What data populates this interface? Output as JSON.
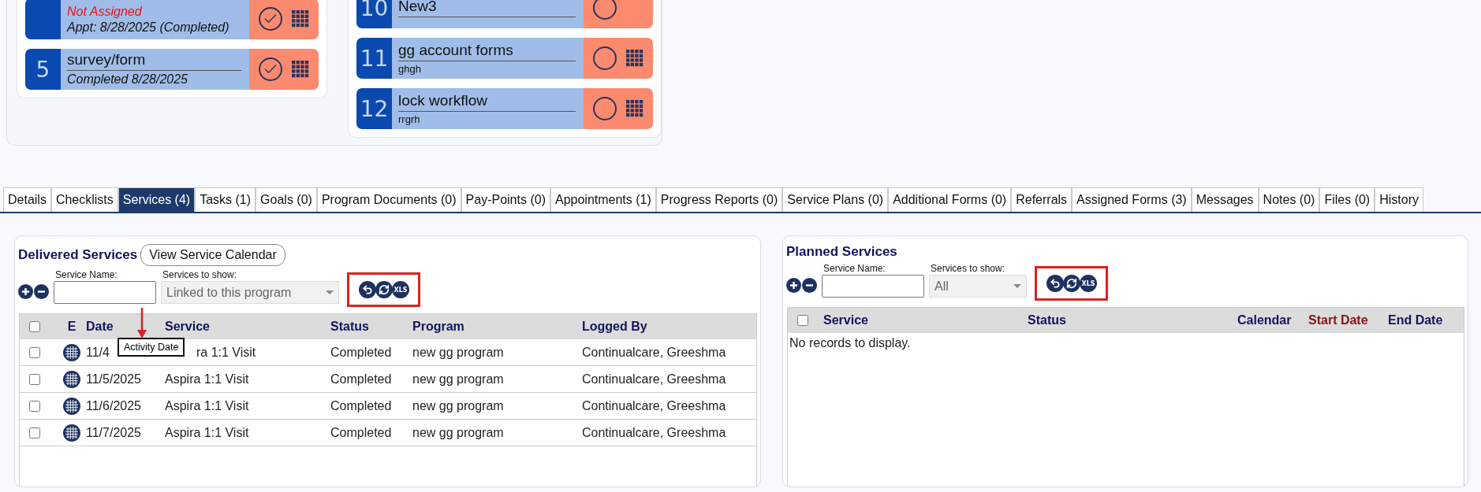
{
  "card_columns": [
    [
      {
        "lines": [
          {
            "text": "Not Assigned",
            "kind": "alert"
          },
          {
            "text": "Appt: 8/28/2025 (Completed)",
            "kind": "italic"
          }
        ],
        "done": true,
        "grid": true
      },
      {
        "number": "5",
        "title": "survey/form",
        "lines": [
          {
            "text": "Completed 8/28/2025",
            "kind": "italic"
          }
        ],
        "done": true,
        "grid": true
      }
    ],
    [
      {
        "number": "10",
        "title": "New3",
        "done": false,
        "grid": false
      },
      {
        "number": "11",
        "title": "gg account forms",
        "lines": [
          {
            "text": "ghgh",
            "kind": "plain"
          }
        ],
        "done": false,
        "grid": true
      },
      {
        "number": "12",
        "title": "lock workflow",
        "lines": [
          {
            "text": "rrgrh",
            "kind": "plain"
          }
        ],
        "done": false,
        "grid": true
      }
    ]
  ],
  "tabs": [
    {
      "label": "Details",
      "selected": false
    },
    {
      "label": "Checklists",
      "selected": false
    },
    {
      "label": "Services (4)",
      "selected": true
    },
    {
      "label": "Tasks (1)",
      "selected": false
    },
    {
      "label": "Goals (0)",
      "selected": false
    },
    {
      "label": "Program Documents (0)",
      "selected": false
    },
    {
      "label": "Pay-Points (0)",
      "selected": false
    },
    {
      "label": "Appointments (1)",
      "selected": false
    },
    {
      "label": "Progress Reports (0)",
      "selected": false
    },
    {
      "label": "Service Plans (0)",
      "selected": false
    },
    {
      "label": "Additional Forms (0)",
      "selected": false
    },
    {
      "label": "Referrals",
      "selected": false
    },
    {
      "label": "Assigned Forms (3)",
      "selected": false
    },
    {
      "label": "Messages",
      "selected": false
    },
    {
      "label": "Notes (0)",
      "selected": false
    },
    {
      "label": "Files (0)",
      "selected": false
    },
    {
      "label": "History",
      "selected": false
    }
  ],
  "delivered": {
    "title": "Delivered Services",
    "calendar_button": "View Service Calendar",
    "name_label": "Service Name:",
    "show_label": "Services to show:",
    "show_value": "Linked to this program",
    "show_disabled": true,
    "tools": [
      {
        "kind": "undo"
      },
      {
        "kind": "refresh"
      },
      {
        "kind": "export",
        "label": "XLS"
      }
    ],
    "header_checked": false,
    "columns": [
      {
        "label": "E"
      },
      {
        "label": "Date"
      },
      {
        "label": "Service"
      },
      {
        "label": "Status"
      },
      {
        "label": "Program"
      },
      {
        "label": "Logged By"
      }
    ],
    "rows": [
      {
        "checked": false,
        "date": "11/4",
        "service": "ra 1:1 Visit",
        "status": "Completed",
        "program": "new gg program",
        "logged_by": "Continualcare, Greeshma"
      },
      {
        "checked": false,
        "date": "11/5/2025",
        "service": "Aspira 1:1 Visit",
        "status": "Completed",
        "program": "new gg program",
        "logged_by": "Continualcare, Greeshma"
      },
      {
        "checked": false,
        "date": "11/6/2025",
        "service": "Aspira 1:1 Visit",
        "status": "Completed",
        "program": "new gg program",
        "logged_by": "Continualcare, Greeshma"
      },
      {
        "checked": false,
        "date": "11/7/2025",
        "service": "Aspira 1:1 Visit",
        "status": "Completed",
        "program": "new gg program",
        "logged_by": "Continualcare, Greeshma"
      }
    ],
    "tooltip": "Activity Date"
  },
  "planned": {
    "title": "Planned Services",
    "name_label": "Service Name:",
    "show_label": "Services to show:",
    "show_value": "All",
    "show_disabled": true,
    "tools": [
      {
        "kind": "undo"
      },
      {
        "kind": "refresh"
      },
      {
        "kind": "export",
        "label": "XLS"
      }
    ],
    "header_checked": false,
    "columns": [
      {
        "label": "Service",
        "sorted": false
      },
      {
        "label": "Status",
        "sorted": false
      },
      {
        "label": "Calendar",
        "sorted": false
      },
      {
        "label": "Start Date",
        "sorted": true
      },
      {
        "label": "End Date",
        "sorted": false
      }
    ],
    "empty": "No records to display."
  }
}
